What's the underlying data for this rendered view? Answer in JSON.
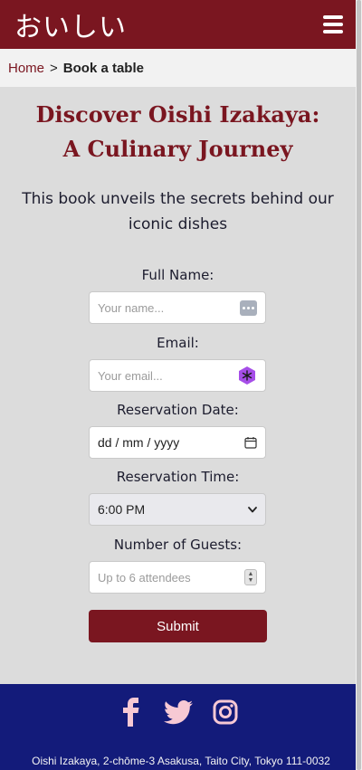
{
  "header": {
    "logo": "おいしい",
    "menu_icon": "hamburger-menu-icon"
  },
  "breadcrumb": {
    "home": "Home",
    "separator": ">",
    "current": "Book a table"
  },
  "hero": {
    "title": "Discover Oishi Izakaya: A Culinary Journey",
    "subtitle": "This book unveils the secrets behind our iconic dishes"
  },
  "form": {
    "name_label": "Full Name:",
    "name_placeholder": "Your name...",
    "email_label": "Email:",
    "email_placeholder": "Your email...",
    "date_label": "Reservation Date:",
    "date_value": "dd / mm / yyyy",
    "time_label": "Reservation Time:",
    "time_value": "6:00 PM",
    "guests_label": "Number of Guests:",
    "guests_placeholder": "Up to 6 attendees",
    "submit_label": "Submit"
  },
  "footer": {
    "social": [
      "facebook-icon",
      "twitter-icon",
      "instagram-icon"
    ],
    "address": "Oishi Izakaya, 2-chōme-3 Asakusa, Taito City, Tokyo 111-0032"
  },
  "colors": {
    "brand": "#7a1620",
    "footer": "#131b7a",
    "social_icon": "#f7c9d4"
  }
}
